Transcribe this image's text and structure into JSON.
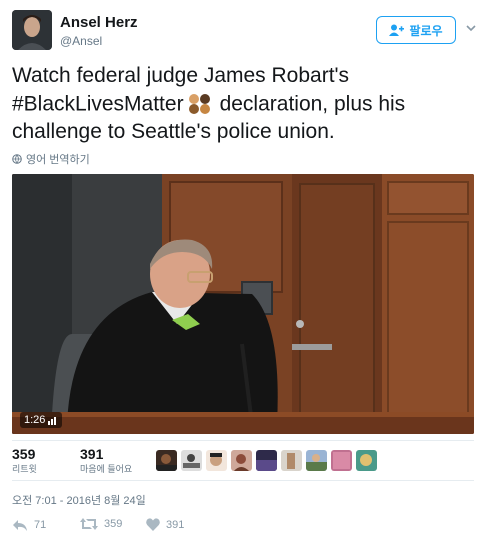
{
  "author": {
    "name": "Ansel Herz",
    "handle": "@Ansel",
    "follow_label": "팔로우"
  },
  "tweet": {
    "line1": "Watch federal judge James Robart's",
    "hashtag": "#BlackLivesMatter",
    "line2_rest": "declaration, plus his",
    "line3": "challenge to Seattle's police union.",
    "translate_label": "영어 번역하기"
  },
  "video": {
    "duration": "1:26"
  },
  "stats": {
    "retweets": "359",
    "retweets_label": "리트윗",
    "likes": "391",
    "likes_label": "마음에 들어요"
  },
  "timestamp": "오전 7:01 - 2016년 8월 24일",
  "actions": {
    "reply_count": "71",
    "retweet_count": "359",
    "like_count": "391"
  },
  "colors": {
    "accent": "#1da1f2",
    "muted": "#657786",
    "text": "#14171a"
  },
  "icons": [
    "follow-user-icon",
    "chevron-down-icon",
    "globe-icon",
    "fist-emoji-icon",
    "reply-icon",
    "retweet-icon",
    "heart-icon"
  ]
}
